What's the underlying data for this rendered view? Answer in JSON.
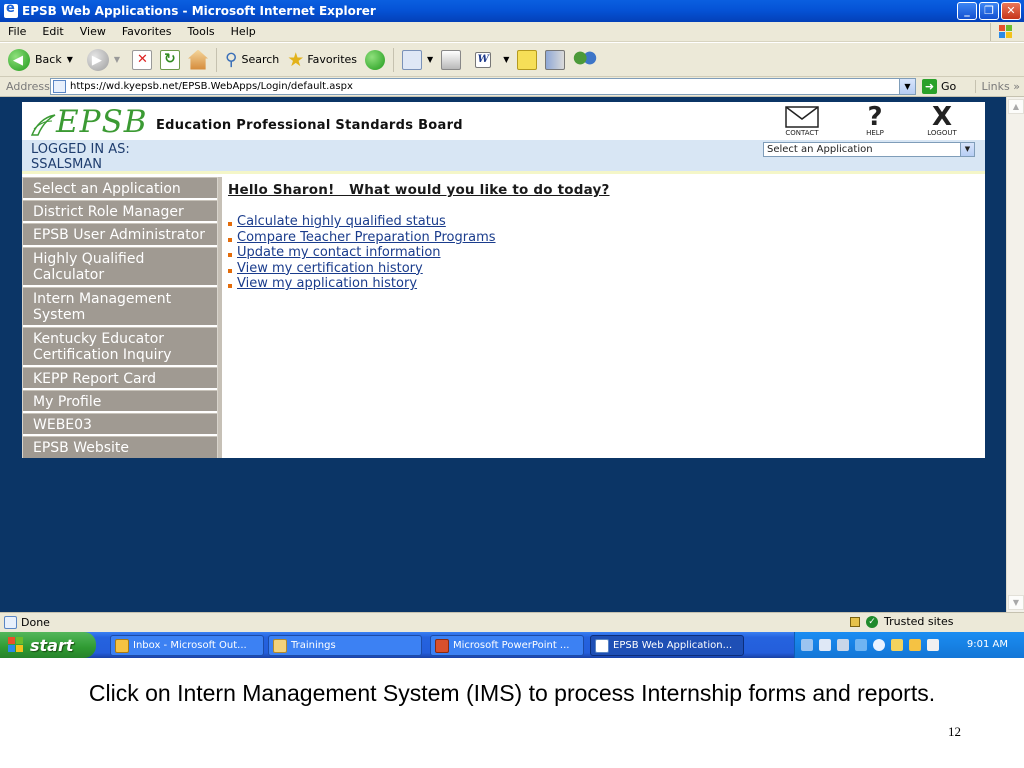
{
  "window": {
    "title": "EPSB Web Applications - Microsoft Internet Explorer"
  },
  "menu": [
    "File",
    "Edit",
    "View",
    "Favorites",
    "Tools",
    "Help"
  ],
  "toolbar": {
    "back": "Back",
    "search": "Search",
    "favorites": "Favorites"
  },
  "address": {
    "label": "Address",
    "url": "https://wd.kyepsb.net/EPSB.WebApps/Login/default.aspx",
    "go": "Go",
    "links": "Links"
  },
  "site": {
    "logo_text": "EPSB",
    "board_title": "Education Professional Standards Board",
    "header_icons": {
      "contact": "CONTACT",
      "help": "HELP",
      "logout": "LOGOUT"
    },
    "logged_in_label": "LOGGED IN AS:",
    "username": "SSALSMAN",
    "app_select": "Select an Application",
    "nav": [
      "Select an Application",
      "District Role Manager",
      "EPSB User Administrator",
      "Highly Qualified Calculator",
      "Intern Management System",
      "Kentucky Educator Certification Inquiry",
      "KEPP Report Card",
      "My Profile",
      "WEBE03",
      "EPSB Website"
    ],
    "greeting": "Hello Sharon!   What would you like to do today?",
    "links": [
      "Calculate highly qualified status",
      "Compare Teacher Preparation Programs",
      "Update my contact information",
      "View my certification history",
      "View my application history"
    ]
  },
  "status": {
    "text": "Done",
    "zone": "Trusted sites"
  },
  "taskbar": {
    "start": "start",
    "tasks": [
      "Inbox - Microsoft Out...",
      "Trainings",
      "Microsoft PowerPoint ...",
      "EPSB Web Application..."
    ],
    "clock": "9:01 AM"
  },
  "slide": {
    "caption": "Click on Intern Management System (IMS) to process Internship forms and reports.",
    "page_number": "12"
  }
}
